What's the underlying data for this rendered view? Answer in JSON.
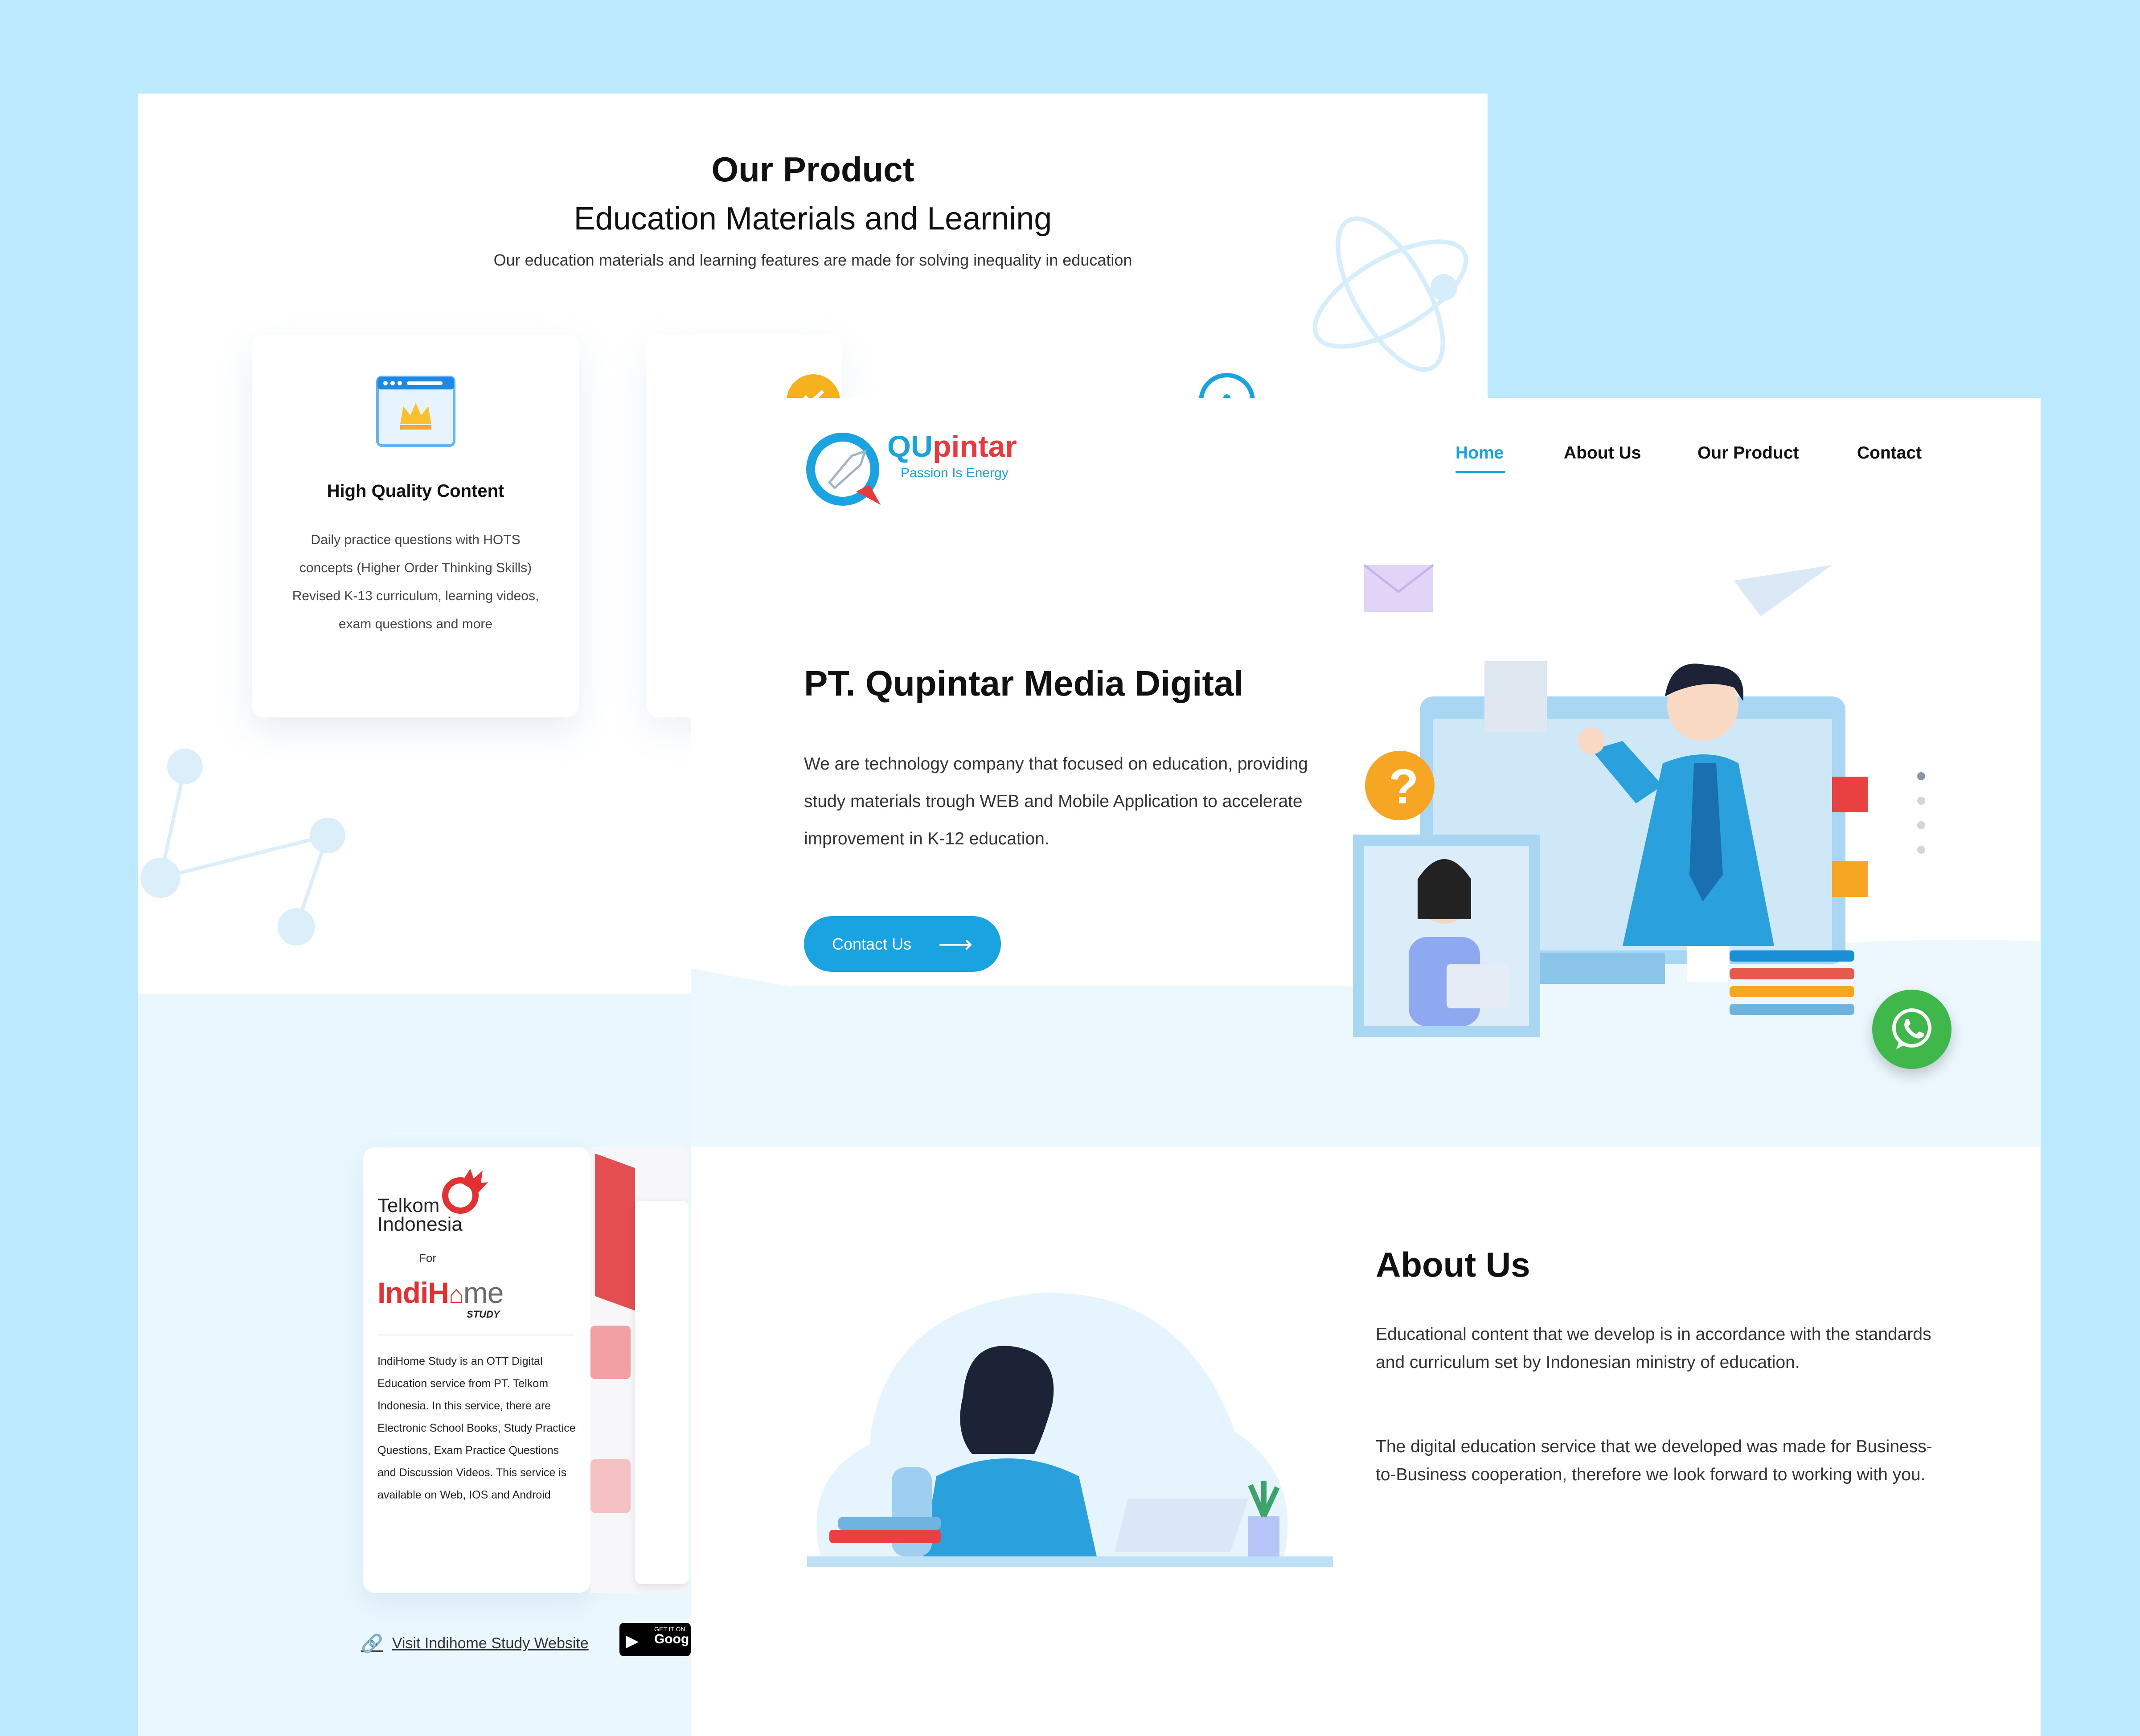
{
  "colors": {
    "accent": "#1aa3e1",
    "brand_red": "#e63a3e",
    "background": "#bde9fe",
    "whatsapp": "#3fb74a"
  },
  "product_page": {
    "title": "Our Product",
    "subtitle": "Education Materials and Learning",
    "description": "Our education materials and learning features are made for solving inequality in education",
    "feature_card": {
      "icon": "browser-crown-icon",
      "title": "High Quality Content",
      "description": "Daily practice questions with HOTS concepts (Higher Order Thinking Skills) Revised K-13 curriculum, learning videos, exam questions and more"
    },
    "partner_card": {
      "company": "Telkom Indonesia",
      "for_label": "For",
      "product_red": "IndiH",
      "product_gray": "me",
      "product_tag": "STUDY",
      "description": "IndiHome Study is an OTT Digital Education service from PT. Telkom Indonesia. In this service, there are Electronic School Books, Study Practice Questions, Exam Practice Questions and Discussion Videos. This service is available on Web, IOS and Android",
      "link_label": "Visit Indihome Study Website",
      "store_small": "GET IT ON",
      "store_big": "Goog"
    }
  },
  "home_page": {
    "logo": {
      "qu": "QU",
      "pintar": "pintar",
      "tagline": "Passion Is Energy"
    },
    "nav": [
      {
        "label": "Home",
        "active": true
      },
      {
        "label": "About Us",
        "active": false
      },
      {
        "label": "Our Product",
        "active": false
      },
      {
        "label": "Contact",
        "active": false
      }
    ],
    "hero": {
      "title": "PT. Qupintar Media Digital",
      "description": "We are technology company that focused on education, providing study materials trough WEB and Mobile Application to accelerate improvement in K-12 education.",
      "cta_label": "Contact Us"
    },
    "about": {
      "title": "About Us",
      "paragraph_1": "Educational content that we develop is in accordance with the standards and curriculum set by Indonesian ministry of education.",
      "paragraph_2": "The digital education service that we developed was made for Business-to-Business cooperation, therefore we look forward to working with you."
    }
  }
}
